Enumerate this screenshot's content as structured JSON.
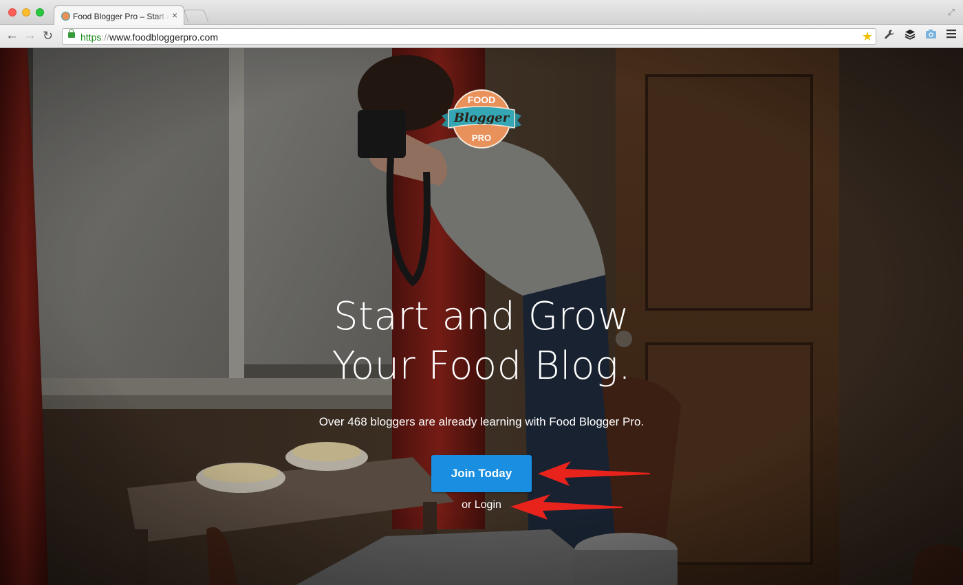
{
  "browser": {
    "tab_title": "Food Blogger Pro – Start and Grow Your Food Blog.",
    "tab_close": "×",
    "url_scheme": "https",
    "url_sep": "://",
    "url_rest": "www.foodbloggerpro.com"
  },
  "logo": {
    "line1": "FOOD",
    "line2": "Blogger",
    "line3": "PRO"
  },
  "hero": {
    "headline_line1": "Start and Grow",
    "headline_line2": "Your Food Blog.",
    "subtext": "Over 468 bloggers are already learning with Food Blogger Pro.",
    "join_button": "Join Today",
    "login_prefix": "or ",
    "login_link": "Login"
  },
  "colors": {
    "join_button": "#1a8ee0",
    "logo_orange": "#e8915a",
    "logo_teal": "#35a6b4",
    "annotation_arrow": "#e8231c"
  },
  "icons": {
    "back": "arrow-left",
    "forward": "arrow-right",
    "reload": "reload",
    "bookmark": "star",
    "extensions": [
      "wrench",
      "layers",
      "camera",
      "menu"
    ]
  }
}
